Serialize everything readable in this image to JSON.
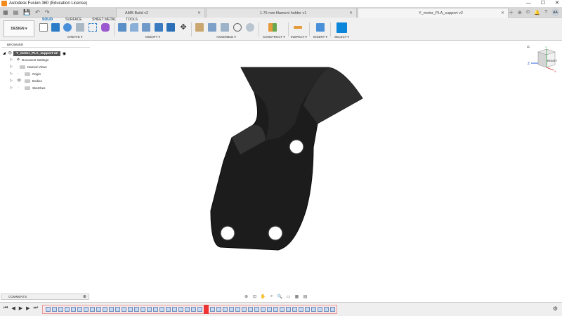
{
  "window": {
    "title": "Autodesk Fusion 360 (Education License)",
    "controls": [
      "—",
      "☐",
      "✕"
    ]
  },
  "tabs": [
    {
      "label": "AMB Build v2",
      "active": false
    },
    {
      "label": "1.75 mm filament holder v1",
      "active": false
    },
    {
      "label": "Y_motor_PLA_support v2",
      "active": true
    }
  ],
  "user_initials": "AA",
  "ribbon": {
    "workspace": "DESIGN ▾",
    "tabs": [
      "SOLID",
      "SURFACE",
      "SHEET METAL",
      "TOOLS"
    ],
    "active_tab": "SOLID",
    "groups": [
      "CREATE ▾",
      "MODIFY ▾",
      "ASSEMBLE ▾",
      "CONSTRUCT ▾",
      "INSPECT ▾",
      "INSERT ▾",
      "SELECT ▾"
    ]
  },
  "browser": {
    "header": "BROWSER",
    "root": "Y_motor_PLA_support v2",
    "items": [
      {
        "label": "Document Settings",
        "icon": "gear-icon"
      },
      {
        "label": "Named Views",
        "icon": "folder-icon"
      },
      {
        "label": "Origin",
        "icon": "folder-icon"
      },
      {
        "label": "Bodies",
        "icon": "folder-icon"
      },
      {
        "label": "Sketches",
        "icon": "folder-icon"
      }
    ]
  },
  "viewcube": {
    "face_label": "RIGHT",
    "axis_z": "Z",
    "axis_x": "X",
    "axis_y": "Y"
  },
  "comments": {
    "label": "COMMENTS"
  },
  "colors": {
    "accent": "#0a68b5",
    "model": "#1c1c1c",
    "timeline_error": "#e33"
  }
}
